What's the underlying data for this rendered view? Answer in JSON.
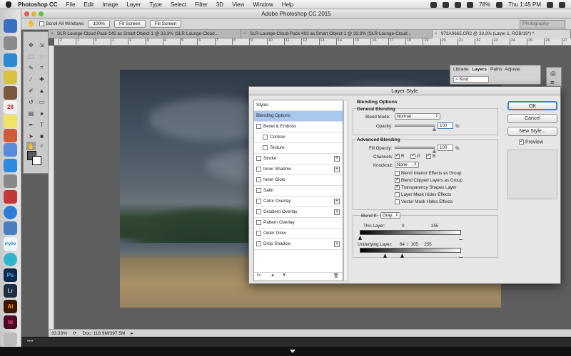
{
  "menubar": {
    "app": "Photoshop CC",
    "items": [
      "File",
      "Edit",
      "Image",
      "Layer",
      "Type",
      "Select",
      "Filter",
      "3D",
      "View",
      "Window",
      "Help"
    ],
    "battery": "78%",
    "clock": "Thu 1:45 PM"
  },
  "window": {
    "title": "Adobe Photoshop CC 2015"
  },
  "options": {
    "scroll_all": "Scroll All Windows",
    "zoom_100": "100%",
    "fit_screen": "Fit Screen",
    "fill_screen": "Fill Screen",
    "workspace": "Photography"
  },
  "tabs": [
    "SLR-Lounge-Cloud-Pack-145 as Smart Object-1 @ 33.3% (SLR-Lounge-Cloud...",
    "SLR-Lounge-Cloud-Pack-403 as Smart Object-1 @ 33.3% (SLR-Lounge-Cloud...",
    "973A0665.CR2 @ 33.3% (Layer 1, RGB/16*) *"
  ],
  "ruler": [
    "2",
    "1",
    "0",
    "1",
    "2",
    "3",
    "4",
    "5",
    "6",
    "7",
    "8",
    "9",
    "10",
    "11",
    "12",
    "13",
    "14",
    "15",
    "16",
    "17",
    "18",
    "19",
    "20",
    "21",
    "22",
    "23",
    "24",
    "25",
    "26",
    "27"
  ],
  "panels": {
    "libraries": "Librarie",
    "layers": "Layers",
    "paths": "Paths",
    "adjust": "Adjuste",
    "kind": "Kind"
  },
  "status": {
    "zoom": "33.33%",
    "doc": "Doc: 118.9M/397.5M"
  },
  "dock": {
    "ps": "Ps",
    "lr": "Lr",
    "ai": "Ai",
    "id": "Id",
    "mylio": "mylio",
    "calendar_date": "28"
  },
  "dialog": {
    "title": "Layer Style",
    "styles": [
      {
        "label": "Styles"
      },
      {
        "label": "Blending Options"
      },
      {
        "label": "Bevel & Emboss"
      },
      {
        "label": "Contour"
      },
      {
        "label": "Texture"
      },
      {
        "label": "Stroke"
      },
      {
        "label": "Inner Shadow"
      },
      {
        "label": "Inner Glow"
      },
      {
        "label": "Satin"
      },
      {
        "label": "Color Overlay"
      },
      {
        "label": "Gradient Overlay"
      },
      {
        "label": "Pattern Overlay"
      },
      {
        "label": "Outer Glow"
      },
      {
        "label": "Drop Shadow"
      }
    ],
    "fx": "fx.",
    "blending_options": "Blending Options",
    "general_blending": "General Blending",
    "blend_mode_label": "Blend Mode:",
    "blend_mode_value": "Normal",
    "opacity_label": "Opacity:",
    "opacity_value": "100",
    "percent": "%",
    "advanced_blending": "Advanced Blending",
    "fill_opacity_label": "Fill Opacity:",
    "fill_opacity_value": "100",
    "channels_label": "Channels:",
    "channel_r": "R",
    "channel_g": "G",
    "channel_b": "B",
    "knockout_label": "Knockout:",
    "knockout_value": "None",
    "checks": [
      {
        "label": "Blend Interior Effects as Group",
        "checked": false
      },
      {
        "label": "Blend Clipped Layers as Group",
        "checked": true
      },
      {
        "label": "Transparency Shapes Layer",
        "checked": true
      },
      {
        "label": "Layer Mask Hides Effects",
        "checked": false
      },
      {
        "label": "Vector Mask Hides Effects",
        "checked": false
      }
    ],
    "blend_if_label": "Blend If:",
    "blend_if_value": "Gray",
    "this_layer_label": "This Layer:",
    "this_layer_low": "0",
    "this_layer_high": "255",
    "underlying_label": "Underlying Layer:",
    "underlying_values": "64  /  105     255",
    "buttons": {
      "ok": "OK",
      "cancel": "Cancel",
      "new_style": "New Style...",
      "preview": "Preview"
    }
  }
}
